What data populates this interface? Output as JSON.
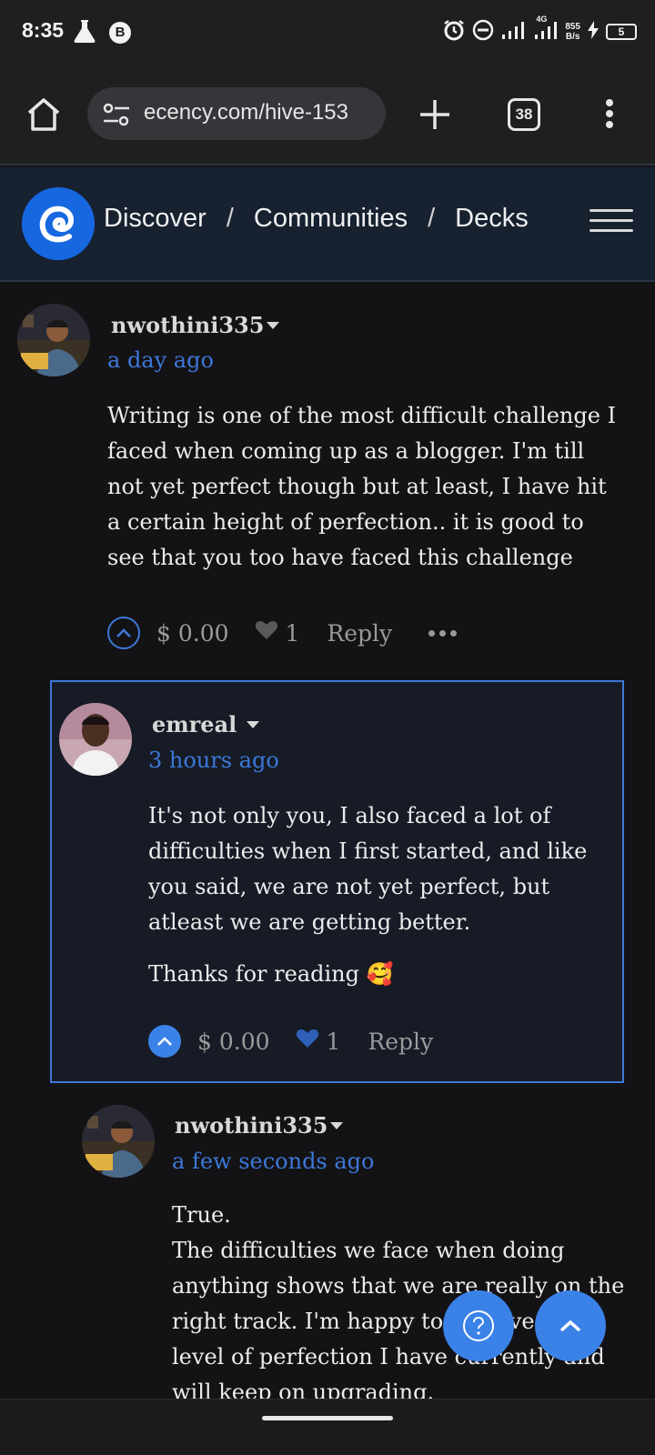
{
  "status_bar": {
    "time": "8:35",
    "b_badge": "B",
    "network_type": "4G",
    "speed_value": "855",
    "speed_unit": "B/s",
    "battery": "5"
  },
  "browser": {
    "url": "ecency.com/hive-153",
    "tab_count": "38"
  },
  "site_nav": {
    "breadcrumbs": [
      "Discover",
      "Communities",
      "Decks"
    ],
    "separator": "/"
  },
  "comments": [
    {
      "author": "nwothini335",
      "time": "a day ago",
      "paragraphs": [
        "Writing is one of the most difficult challenge I faced when coming up as a blogger. I'm till not yet perfect though but at least, I have hit a certain height of perfection.. it is good to see that you too have faced this challenge"
      ],
      "payout": "$ 0.00",
      "votes": "1",
      "reply_label": "Reply"
    },
    {
      "author": "emreal",
      "time": "3 hours ago",
      "paragraphs": [
        "It's not only you, I also faced a lot of difficulties when I first started, and like you said, we are not yet perfect, but atleast we are getting better.",
        "Thanks for reading 🥰"
      ],
      "payout": "$ 0.00",
      "votes": "1",
      "reply_label": "Reply"
    },
    {
      "author": "nwothini335",
      "time": "a few seconds ago",
      "paragraphs": [
        "True.",
        "The difficulties we face when doing anything shows that we are really on the right track. I'm happy to achieve the level of perfection I have currently and will keep on upgrading."
      ]
    }
  ],
  "colors": {
    "accent": "#3b82e8",
    "link": "#3d78d8",
    "nav_bg": "#172130",
    "page_bg": "#131214"
  }
}
